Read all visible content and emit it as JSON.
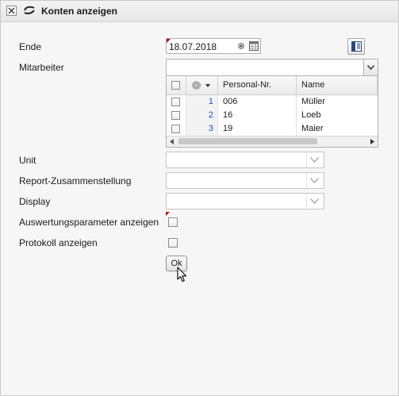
{
  "window": {
    "title": "Konten anzeigen",
    "close_icon": "close-icon",
    "app_icon": "konten-icon"
  },
  "form": {
    "ende": {
      "label": "Ende",
      "value": "18.07.2018"
    },
    "mitarbeiter": {
      "label": "Mitarbeiter",
      "value": "",
      "grid": {
        "columns": [
          "",
          "",
          "Personal-Nr.",
          "Name"
        ],
        "rows": [
          {
            "num": "1",
            "personal_nr": "006",
            "name": "Müller"
          },
          {
            "num": "2",
            "personal_nr": "16",
            "name": "Loeb"
          },
          {
            "num": "3",
            "personal_nr": "19",
            "name": "Maier"
          }
        ]
      }
    },
    "unit": {
      "label": "Unit",
      "value": ""
    },
    "report": {
      "label": "Report-Zusammenstellung",
      "value": ""
    },
    "display": {
      "label": "Display",
      "value": ""
    },
    "auswertung": {
      "label": "Auswertungsparameter anzeigen",
      "checked": false
    },
    "protokoll": {
      "label": "Protokoll anzeigen",
      "checked": false
    },
    "ok_label": "Ok"
  },
  "colors": {
    "required_marker": "#c00000",
    "row_number": "#1a55b8"
  }
}
